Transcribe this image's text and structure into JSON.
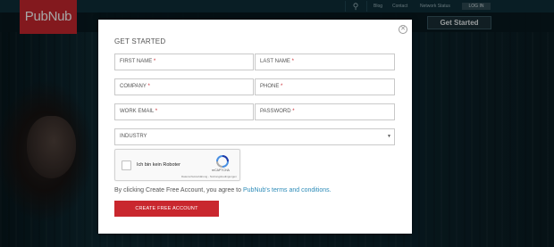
{
  "header": {
    "logo_text": "PubNub",
    "nav_links": [
      "Blog",
      "Contact",
      "Network Status"
    ],
    "login_label": "LOG IN",
    "get_started_label": "Get Started",
    "search_icon": "search-icon"
  },
  "modal": {
    "title": "GET STARTED",
    "close_icon": "close-icon",
    "fields": {
      "first_name": "FIRST NAME",
      "last_name": "LAST NAME",
      "company": "COMPANY",
      "phone": "PHONE",
      "work_email": "WORK EMAIL",
      "password": "PASSWORD"
    },
    "required_marker": "*",
    "industry": {
      "selected": "INDUSTRY",
      "arrow": "▼"
    },
    "captcha": {
      "checkbox_label": "Ich bin kein Roboter",
      "brand": "reCAPTCHA",
      "privacy": "Datenschutzerklärung - Nutzungsbedingungen"
    },
    "terms_prefix": "By clicking Create Free Account, you agree to",
    "terms_link": "PubNub's terms and conditions.",
    "submit_label": "CREATE FREE ACCOUNT"
  },
  "colors": {
    "brand_red": "#c9272e",
    "link_blue": "#2c8bb8",
    "topbar": "#0e2f3a"
  }
}
